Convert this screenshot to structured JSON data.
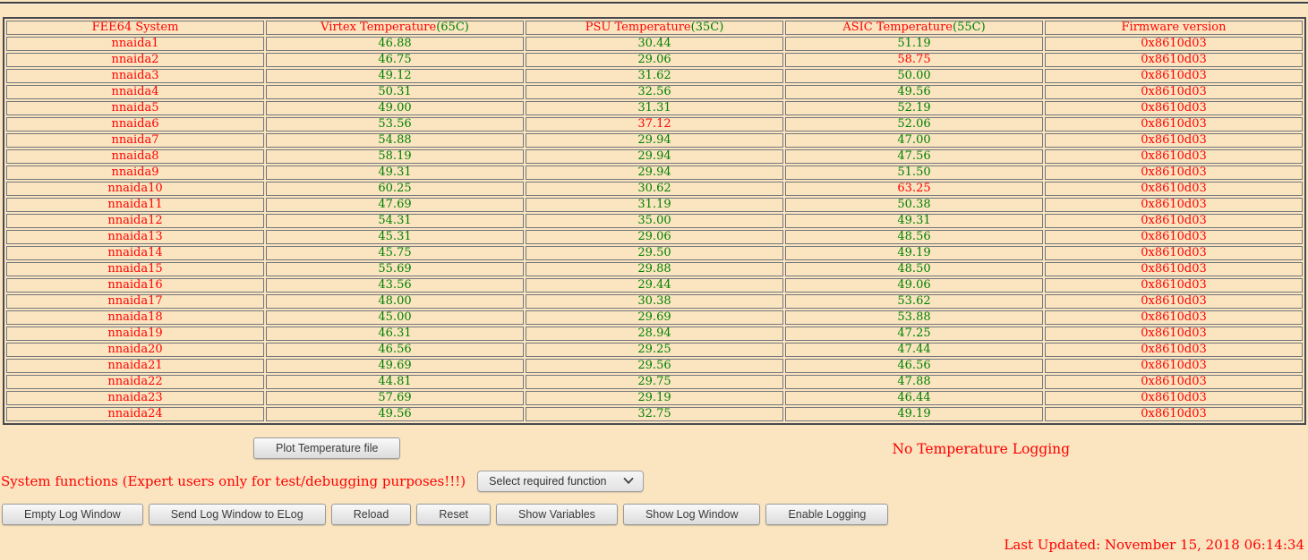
{
  "page": {
    "background_color": "#FAE5C0",
    "alert_color": "#FF0000",
    "ok_color": "#008000"
  },
  "table": {
    "columns": [
      {
        "title": "FEE64 System"
      },
      {
        "title": "Virtex Temperature",
        "limit": "(65C)"
      },
      {
        "title": "PSU Temperature",
        "limit": "(35C)"
      },
      {
        "title": "ASIC Temperature",
        "limit": "(55C)"
      },
      {
        "title": "Firmware version"
      }
    ],
    "rows": [
      {
        "system": "nnaida1",
        "virtex": "46.88",
        "psu": "30.44",
        "asic": "51.19",
        "firmware": "0x8610d03",
        "alarms": []
      },
      {
        "system": "nnaida2",
        "virtex": "46.75",
        "psu": "29.06",
        "asic": "58.75",
        "firmware": "0x8610d03",
        "alarms": [
          "asic"
        ]
      },
      {
        "system": "nnaida3",
        "virtex": "49.12",
        "psu": "31.62",
        "asic": "50.00",
        "firmware": "0x8610d03",
        "alarms": []
      },
      {
        "system": "nnaida4",
        "virtex": "50.31",
        "psu": "32.56",
        "asic": "49.56",
        "firmware": "0x8610d03",
        "alarms": []
      },
      {
        "system": "nnaida5",
        "virtex": "49.00",
        "psu": "31.31",
        "asic": "52.19",
        "firmware": "0x8610d03",
        "alarms": []
      },
      {
        "system": "nnaida6",
        "virtex": "53.56",
        "psu": "37.12",
        "asic": "52.06",
        "firmware": "0x8610d03",
        "alarms": [
          "psu"
        ]
      },
      {
        "system": "nnaida7",
        "virtex": "54.88",
        "psu": "29.94",
        "asic": "47.00",
        "firmware": "0x8610d03",
        "alarms": []
      },
      {
        "system": "nnaida8",
        "virtex": "58.19",
        "psu": "29.94",
        "asic": "47.56",
        "firmware": "0x8610d03",
        "alarms": []
      },
      {
        "system": "nnaida9",
        "virtex": "49.31",
        "psu": "29.94",
        "asic": "51.50",
        "firmware": "0x8610d03",
        "alarms": []
      },
      {
        "system": "nnaida10",
        "virtex": "60.25",
        "psu": "30.62",
        "asic": "63.25",
        "firmware": "0x8610d03",
        "alarms": [
          "asic"
        ]
      },
      {
        "system": "nnaida11",
        "virtex": "47.69",
        "psu": "31.19",
        "asic": "50.38",
        "firmware": "0x8610d03",
        "alarms": []
      },
      {
        "system": "nnaida12",
        "virtex": "54.31",
        "psu": "35.00",
        "asic": "49.31",
        "firmware": "0x8610d03",
        "alarms": []
      },
      {
        "system": "nnaida13",
        "virtex": "45.31",
        "psu": "29.06",
        "asic": "48.56",
        "firmware": "0x8610d03",
        "alarms": []
      },
      {
        "system": "nnaida14",
        "virtex": "45.75",
        "psu": "29.50",
        "asic": "49.19",
        "firmware": "0x8610d03",
        "alarms": []
      },
      {
        "system": "nnaida15",
        "virtex": "55.69",
        "psu": "29.88",
        "asic": "48.50",
        "firmware": "0x8610d03",
        "alarms": []
      },
      {
        "system": "nnaida16",
        "virtex": "43.56",
        "psu": "29.44",
        "asic": "49.06",
        "firmware": "0x8610d03",
        "alarms": []
      },
      {
        "system": "nnaida17",
        "virtex": "48.00",
        "psu": "30.38",
        "asic": "53.62",
        "firmware": "0x8610d03",
        "alarms": []
      },
      {
        "system": "nnaida18",
        "virtex": "45.00",
        "psu": "29.69",
        "asic": "53.88",
        "firmware": "0x8610d03",
        "alarms": []
      },
      {
        "system": "nnaida19",
        "virtex": "46.31",
        "psu": "28.94",
        "asic": "47.25",
        "firmware": "0x8610d03",
        "alarms": []
      },
      {
        "system": "nnaida20",
        "virtex": "46.56",
        "psu": "29.25",
        "asic": "47.44",
        "firmware": "0x8610d03",
        "alarms": []
      },
      {
        "system": "nnaida21",
        "virtex": "49.69",
        "psu": "29.56",
        "asic": "46.56",
        "firmware": "0x8610d03",
        "alarms": []
      },
      {
        "system": "nnaida22",
        "virtex": "44.81",
        "psu": "29.75",
        "asic": "47.88",
        "firmware": "0x8610d03",
        "alarms": []
      },
      {
        "system": "nnaida23",
        "virtex": "57.69",
        "psu": "29.19",
        "asic": "46.44",
        "firmware": "0x8610d03",
        "alarms": []
      },
      {
        "system": "nnaida24",
        "virtex": "49.56",
        "psu": "32.75",
        "asic": "49.19",
        "firmware": "0x8610d03",
        "alarms": []
      }
    ]
  },
  "controls": {
    "plot_button_label": "Plot Temperature file",
    "logging_status": "No Temperature Logging",
    "system_functions_label": "System functions (Expert users only for test/debugging purposes!!!)",
    "function_select_value": "Select required function",
    "log_buttons": [
      "Empty Log Window",
      "Send Log Window to ELog",
      "Reload",
      "Reset",
      "Show Variables",
      "Show Log Window",
      "Enable Logging"
    ],
    "last_updated": "Last Updated: November 15, 2018 06:14:34"
  }
}
